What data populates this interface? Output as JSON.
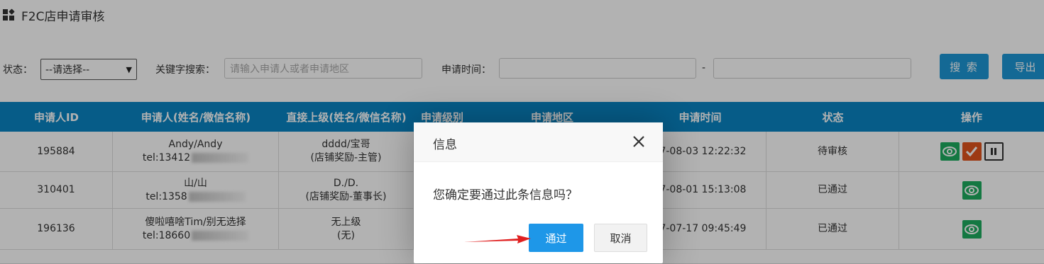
{
  "page": {
    "title": "F2C店申请审核"
  },
  "filters": {
    "status_label": "状态：",
    "status_value": "--请选择--",
    "keyword_label": "关键字搜索：",
    "keyword_placeholder": "请输入申请人或者申请地区",
    "time_label": "申请时间：",
    "time_separator": "-",
    "search_button": "搜 索",
    "export_button": "导出"
  },
  "table": {
    "headers": [
      "申请人ID",
      "申请人(姓名/微信名称)",
      "直接上级(姓名/微信名称)",
      "申请级别",
      "申请地区",
      "申请时间",
      "状态",
      "操作"
    ],
    "rows": [
      {
        "id": "195884",
        "name": "Andy/Andy",
        "tel": "tel:13412",
        "superior": "dddd/宝哥",
        "superior_role": "(店铺奖励-主管)",
        "time": "17-08-03 12:22:32",
        "status": "待审核"
      },
      {
        "id": "310401",
        "name": "山/山",
        "tel": "tel:1358",
        "superior": "D./D.",
        "superior_role": "(店铺奖励-董事长)",
        "time": "17-08-01 15:13:08",
        "status": "已通过"
      },
      {
        "id": "196136",
        "name": "傻啦嘻啥Tim/别无选择",
        "tel": "tel:18660",
        "superior": "无上级",
        "superior_role": "(无)",
        "time": "17-07-17 09:45:49",
        "status": "已通过"
      }
    ]
  },
  "dialog": {
    "title": "信息",
    "message": "您确定要通过此条信息吗？",
    "ok_label": "通过",
    "cancel_label": "取消"
  },
  "colors": {
    "header_bg": "#0a85c3",
    "primary": "#1e97e8",
    "eye": "#1dac5f",
    "check": "#e1541e",
    "arrow": "#e02020"
  }
}
